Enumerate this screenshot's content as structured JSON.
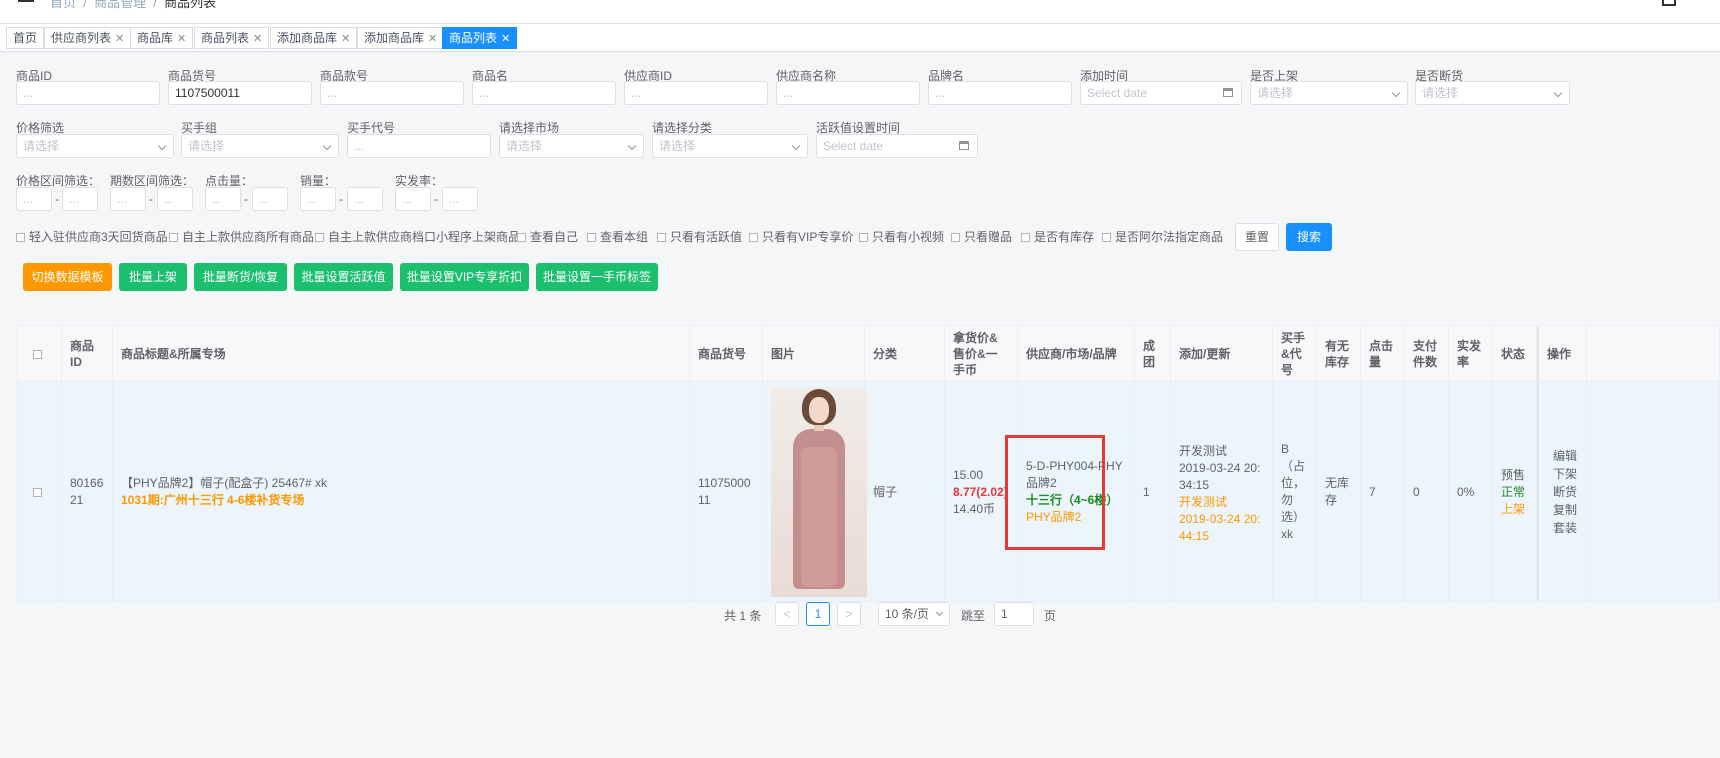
{
  "topbar": {
    "crumb_home": "首页",
    "crumb_section": "商品管理",
    "crumb_current": "商品列表"
  },
  "tags": [
    {
      "label": "首页",
      "closable": false,
      "active": false
    },
    {
      "label": "供应商列表",
      "closable": true,
      "active": false
    },
    {
      "label": "商品库",
      "closable": true,
      "active": false
    },
    {
      "label": "商品列表",
      "closable": true,
      "active": false
    },
    {
      "label": "添加商品库",
      "closable": true,
      "active": false
    },
    {
      "label": "添加商品库",
      "closable": true,
      "active": false
    },
    {
      "label": "商品列表",
      "closable": true,
      "active": true
    }
  ],
  "filters": {
    "row1": [
      {
        "label": "商品ID",
        "value": "",
        "placeholder": "..."
      },
      {
        "label": "商品货号",
        "value": "1107500011",
        "placeholder": "..."
      },
      {
        "label": "商品款号",
        "value": "",
        "placeholder": "..."
      },
      {
        "label": "商品名",
        "value": "",
        "placeholder": "..."
      },
      {
        "label": "供应商ID",
        "value": "",
        "placeholder": "..."
      },
      {
        "label": "供应商名称",
        "value": "",
        "placeholder": "..."
      },
      {
        "label": "品牌名",
        "value": "",
        "placeholder": "..."
      },
      {
        "label": "添加时间",
        "value": "",
        "placeholder": "Select date"
      },
      {
        "label": "是否上架",
        "value": "",
        "placeholder": "请选择"
      },
      {
        "label": "是否断货",
        "value": "",
        "placeholder": "请选择"
      }
    ],
    "row2": [
      {
        "label": "价格筛选",
        "value": "",
        "placeholder": "请选择"
      },
      {
        "label": "买手组",
        "value": "",
        "placeholder": "请选择"
      },
      {
        "label": "买手代号",
        "value": "",
        "placeholder": "..."
      },
      {
        "label": "请选择市场",
        "value": "",
        "placeholder": "请选择"
      },
      {
        "label": "请选择分类",
        "value": "",
        "placeholder": "请选择"
      },
      {
        "label": "活跃值设置时间",
        "value": "",
        "placeholder": "Select date"
      }
    ],
    "row3": [
      {
        "label": "价格区间筛选：",
        "placeholder": "..."
      },
      {
        "label": "期数区间筛选：",
        "placeholder": "..."
      },
      {
        "label": "点击量：",
        "placeholder": "..."
      },
      {
        "label": "销量：",
        "placeholder": "..."
      },
      {
        "label": "实发率：",
        "placeholder": "..."
      }
    ],
    "range_sep": "-"
  },
  "checkboxes": [
    "轻入驻供应商3天回货商品",
    "自主上款供应商所有商品",
    "自主上款供应商档口小程序上架商品",
    "查看自己",
    "查看本组",
    "只看有活跃值",
    "只看有VIP专享价",
    "只看有小视频",
    "只看赠品",
    "是否有库存",
    "是否阿尔法指定商品"
  ],
  "actions": {
    "reset": "重置",
    "search": "搜索"
  },
  "batch_buttons": [
    "切换数据模板",
    "批量上架",
    "批量断货/恢复",
    "批量设置活跃值",
    "批量设置VIP专享折扣",
    "批量设置一手币标签"
  ],
  "table": {
    "headers": [
      "商品ID",
      "商品标题&所属专场",
      "商品货号",
      "图片",
      "分类",
      "拿货价&售价&一手币",
      "供应商/市场/品牌",
      "成团",
      "添加/更新",
      "买手&代号",
      "有无库存",
      "点击量",
      "支付件数",
      "实发率",
      "状态",
      "操作"
    ],
    "row": {
      "id": "8016621",
      "title": "【PHY品牌2】帽子(配盒子) 25467# xk",
      "session": "1031期:广州十三行 4-6楼补货专场",
      "sku": "1107500011",
      "category": "帽子",
      "cost_price": "15.00",
      "sale_price": "8.77(2.02)",
      "coins": "14.40币",
      "supplier": "5-D-PHY004-PHY品牌2",
      "market": "十三行（4~6楼）",
      "brand": "PHY品牌2",
      "group": "1",
      "added_by": "开发测试",
      "added_at": "2019-03-24 20:34:15",
      "updated_by": "开发测试",
      "updated_at": "2019-03-24 20:44:15",
      "buyer": "B（占位，勿选）xk",
      "stock": "无库存",
      "clicks": "7",
      "paid": "0",
      "ship_rate": "0%",
      "status_presale": "预售",
      "status_normal": "正常",
      "status_listed": "上架",
      "ops": [
        "编辑",
        "下架",
        "断货",
        "复制",
        "套装"
      ]
    }
  },
  "pagination": {
    "total": "共 1 条",
    "prev": "<",
    "current": "1",
    "next": ">",
    "size": "10 条/页",
    "goto_label": "跳至",
    "goto_value": "1",
    "page_suffix": "页"
  },
  "colors": {
    "primary": "#1890ff",
    "orange": "#ff9800",
    "green": "#1cbf6e",
    "highlight": "#e53935"
  }
}
